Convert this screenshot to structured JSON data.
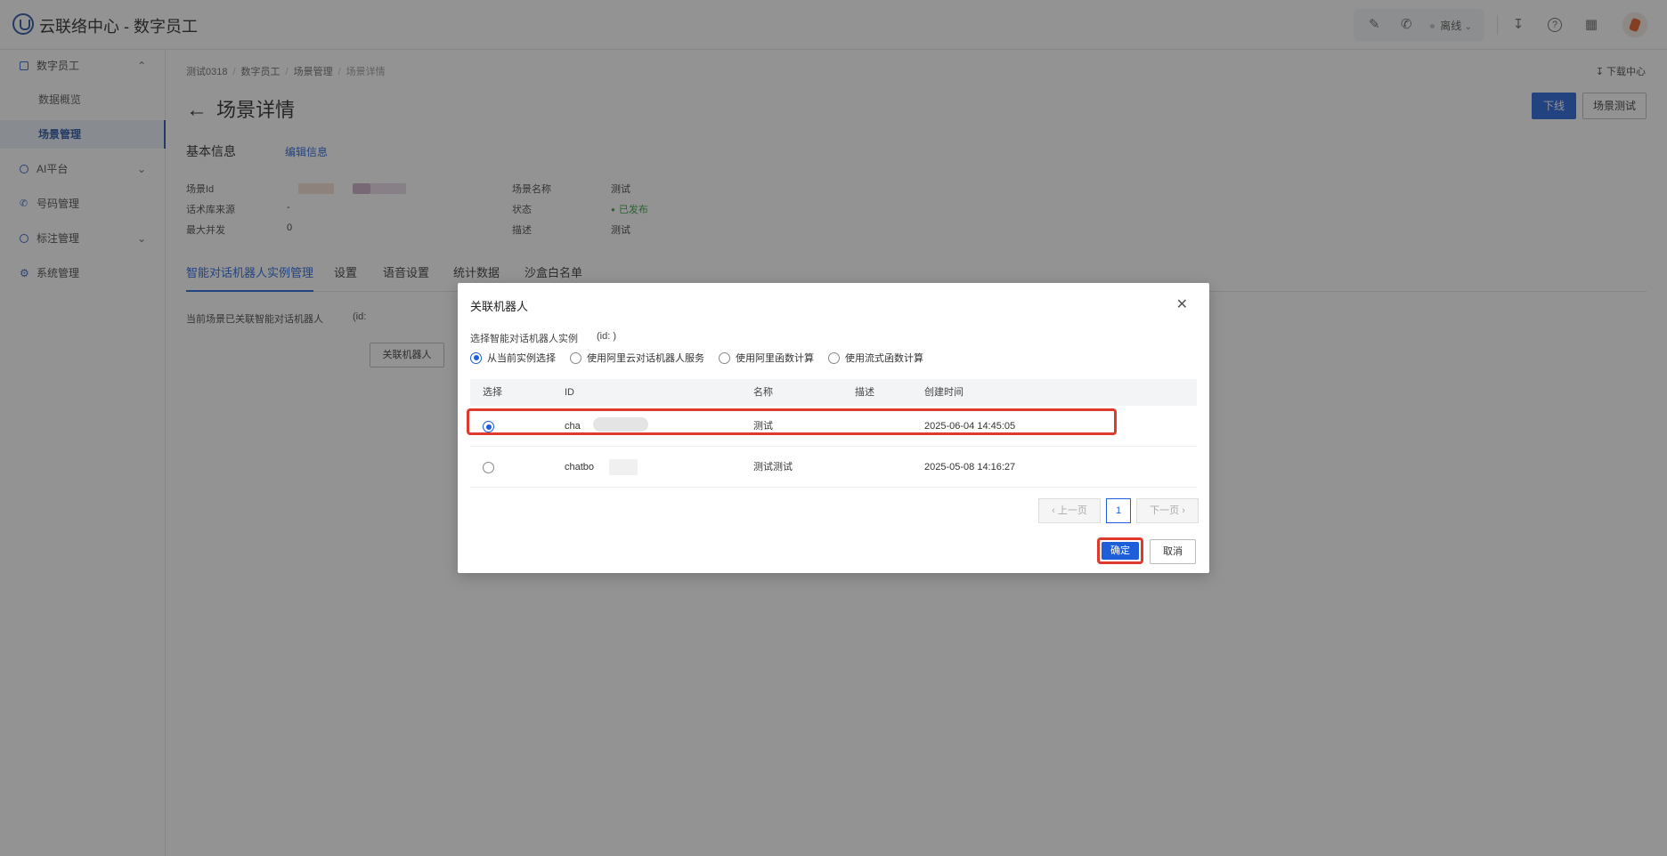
{
  "app": {
    "title": "云联络中心 - 数字员工"
  },
  "topbar": {
    "status": "离线"
  },
  "sidebar": {
    "items": [
      {
        "label": "数字员工"
      },
      {
        "label": "数据概览"
      },
      {
        "label": "场景管理"
      },
      {
        "label": "AI平台"
      },
      {
        "label": "号码管理"
      },
      {
        "label": "标注管理"
      },
      {
        "label": "系统管理"
      }
    ]
  },
  "breadcrumb": [
    "测试0318",
    "数字员工",
    "场景管理",
    "场景详情"
  ],
  "header": {
    "download_center": "下载中心",
    "title": "场景详情",
    "offline_button": "下线",
    "test_button": "场景测试"
  },
  "basic_info": {
    "section_title": "基本信息",
    "edit_link": "编辑信息",
    "scene_id_label": "场景Id",
    "corpus_source_label": "话术库来源",
    "corpus_source_value": "-",
    "max_concurrency_label": "最大并发",
    "max_concurrency_value": "0",
    "scene_name_label": "场景名称",
    "scene_name_value": "测试",
    "status_label": "状态",
    "status_value": "已发布",
    "description_label": "描述",
    "description_value": "测试"
  },
  "tabs": [
    "智能对话机器人实例管理",
    "设置",
    "语音设置",
    "统计数据",
    "沙盒白名单"
  ],
  "linked": {
    "text": "当前场景已关联智能对话机器人",
    "id_prefix": "(id:",
    "button": "关联机器人"
  },
  "modal": {
    "title": "关联机器人",
    "select_label": "选择智能对话机器人实例",
    "select_id": "(id:                               )",
    "options": [
      "从当前实例选择",
      "使用阿里云对话机器人服务",
      "使用阿里函数计算",
      "使用流式函数计算"
    ],
    "columns": [
      "选择",
      "ID",
      "名称",
      "描述",
      "创建时间"
    ],
    "rows": [
      {
        "id": "cha",
        "name": "测试",
        "desc": "",
        "created": "2025-06-04 14:45:05"
      },
      {
        "id": "chatbo",
        "name": "测试测试",
        "desc": "",
        "created": "2025-05-08 14:16:27"
      }
    ],
    "pager": {
      "prev": "上一页",
      "page": "1",
      "next": "下一页"
    },
    "confirm": "确定",
    "cancel": "取消"
  },
  "colors": {
    "primary": "#1f5ed9",
    "highlight": "#e03a2e",
    "success": "#2e9d3a"
  }
}
